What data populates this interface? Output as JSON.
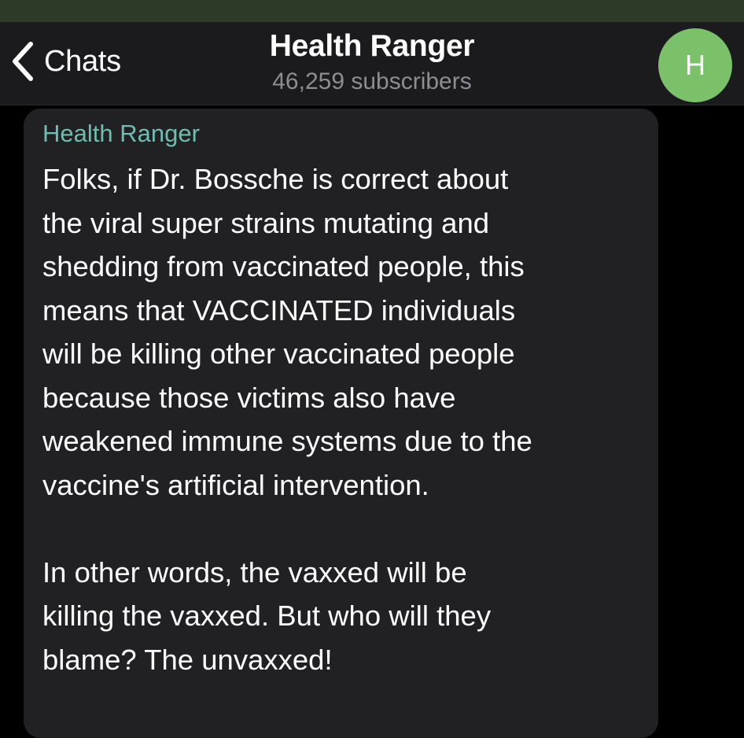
{
  "header": {
    "back_label": "Chats",
    "title": "Health Ranger",
    "subtitle": "46,259 subscribers",
    "avatar_initial": "H",
    "avatar_color": "#7bc16a"
  },
  "message": {
    "sender": "Health Ranger",
    "sender_color": "#6fbdb0",
    "paragraphs": [
      "Folks, if Dr. Bossche is correct about\nthe viral super strains mutating and\nshedding from vaccinated people, this\nmeans that VACCINATED individuals\nwill be killing other vaccinated people\nbecause those victims also have\nweakened immune systems due to the\nvaccine's artificial intervention.",
      "In other words, the vaxxed will be\nkilling the vaxxed. But who will they\nblame? The unvaxxed!"
    ]
  }
}
